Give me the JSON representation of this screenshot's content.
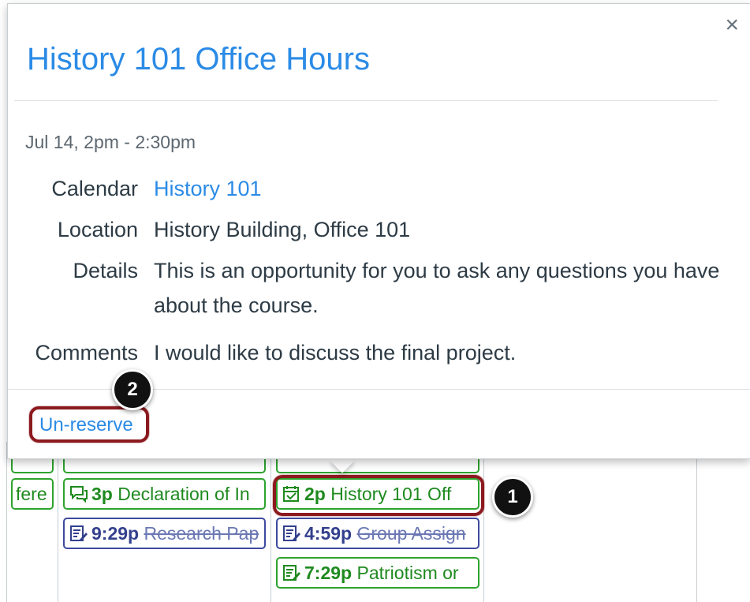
{
  "popover": {
    "title": "History 101 Office Hours",
    "close_symbol": "×",
    "date": "Jul 14, 2pm - 2:30pm",
    "fields": {
      "calendar_label": "Calendar",
      "calendar_value": "History 101",
      "location_label": "Location",
      "location_value": "History Building, Office 101",
      "details_label": "Details",
      "details_value": "This is an opportunity for you to ask any questions you have about the course.",
      "comments_label": "Comments",
      "comments_value": "I would like to discuss the final project."
    },
    "unreserve_label": "Un-reserve"
  },
  "calendar_events": {
    "col0_event_text": "fere",
    "col1_event1": {
      "time": "3p",
      "title": "Declaration of In"
    },
    "col1_event2": {
      "time": "9:29p",
      "title": "Research Pap"
    },
    "col2_event1": {
      "time": "2p",
      "title": "History 101 Off"
    },
    "col2_event2": {
      "time": "4:59p",
      "title": "Group Assign"
    },
    "col2_event3": {
      "time": "7:29p",
      "title": "Patriotism or"
    }
  },
  "callouts": {
    "badge1": "1",
    "badge2": "2"
  },
  "colors": {
    "link": "#2b8be6",
    "event_green": "#2ea32e",
    "event_blue": "#3d4a9e",
    "callout_ring": "#8b1a1f"
  },
  "icons": [
    "close-icon",
    "discussion-icon",
    "assignment-icon",
    "calendar-check-icon"
  ]
}
